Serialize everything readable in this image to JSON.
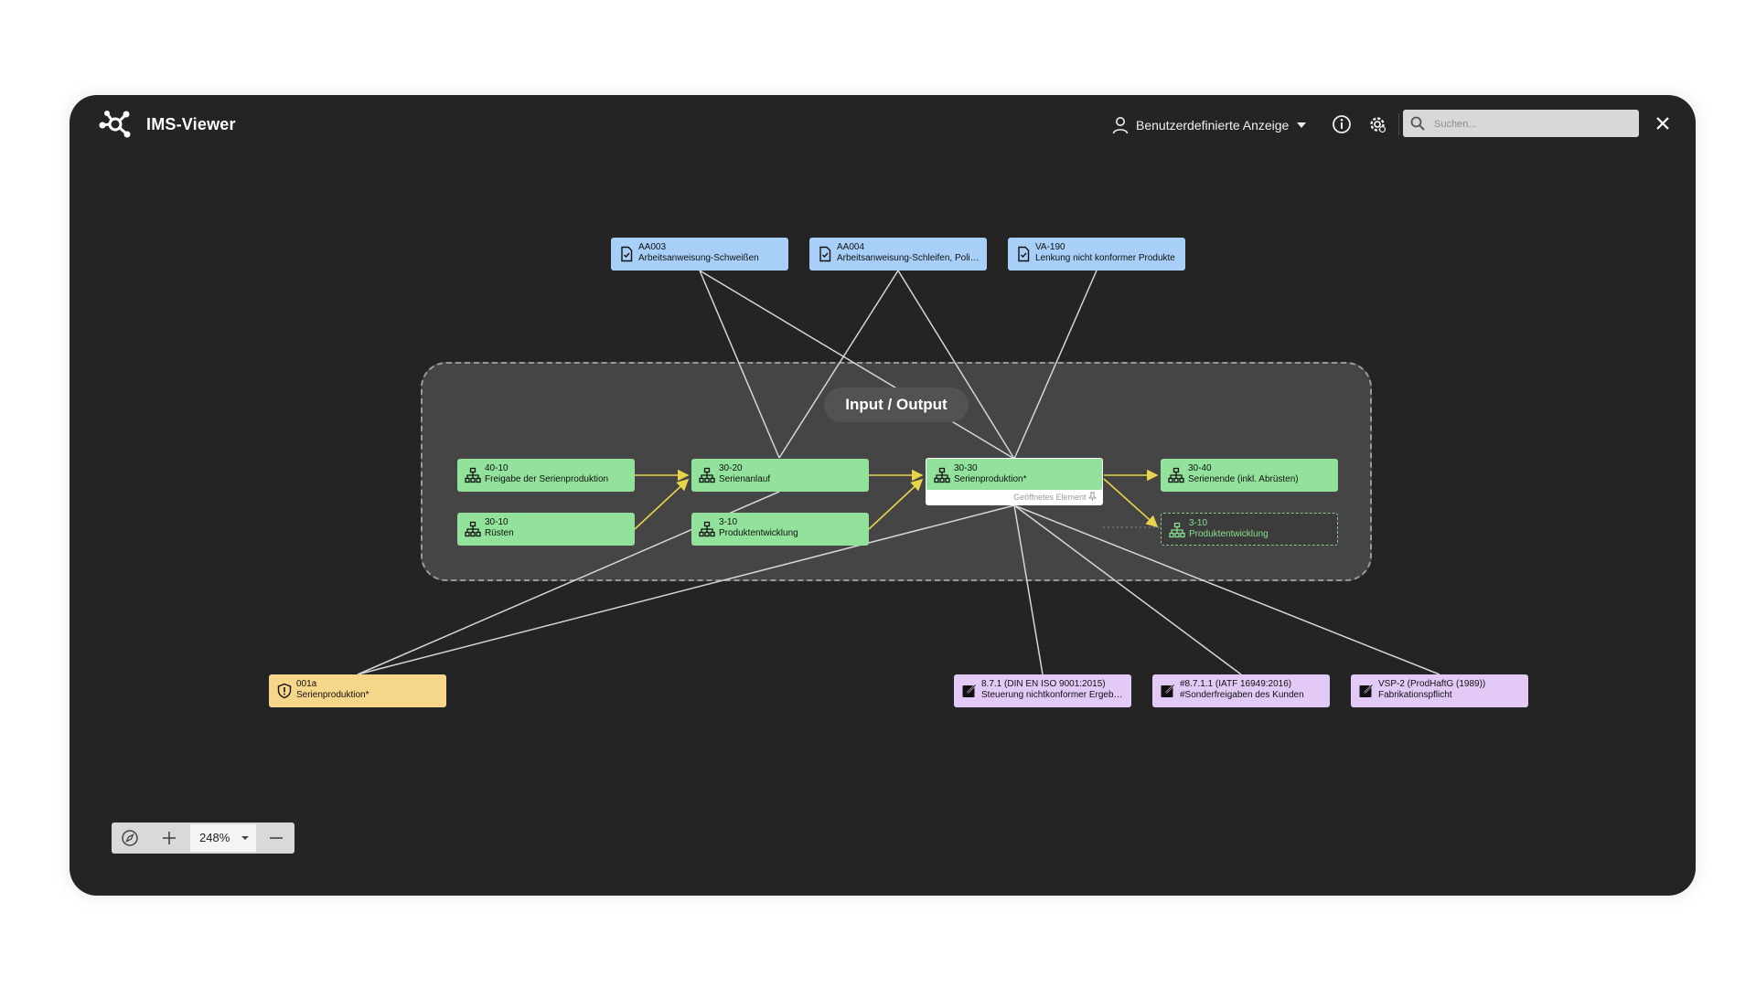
{
  "app": {
    "title": "IMS-Viewer"
  },
  "header": {
    "view_label": "Benutzerdefinierte Anzeige",
    "search_placeholder": "Suchen..."
  },
  "group": {
    "label": "Input / Output"
  },
  "nodes": {
    "aa003": {
      "code": "AA003",
      "title": "Arbeitsanweisung-Schweißen"
    },
    "aa004": {
      "code": "AA004",
      "title": "Arbeitsanweisung-Schleifen, Polier..."
    },
    "va190": {
      "code": "VA-190",
      "title": "Lenkung nicht konformer Produkte"
    },
    "p4010": {
      "code": "40-10",
      "title": "Freigabe der Serienproduktion"
    },
    "p3010": {
      "code": "30-10",
      "title": "Rüsten"
    },
    "p3020": {
      "code": "30-20",
      "title": "Serienanlauf"
    },
    "p310": {
      "code": "3-10",
      "title": "Produktentwicklung"
    },
    "p3030": {
      "code": "30-30",
      "title": "Serienproduktion*",
      "tag": "Geöffnetes Element"
    },
    "p3040": {
      "code": "30-40",
      "title": "Serienende (inkl. Abrüsten)"
    },
    "p310b": {
      "code": "3-10",
      "title": "Produktentwicklung"
    },
    "r001a": {
      "code": "001a",
      "title": "Serienproduktion*"
    },
    "n871": {
      "code": "8.7.1 (DIN EN ISO 9001:2015)",
      "title": "Steuerung nichtkonformer Ergebn..."
    },
    "n8711": {
      "code": "#8.7.1.1 (IATF 16949:2016)",
      "title": "#Sonderfreigaben des Kunden"
    },
    "vsp2": {
      "code": "VSP-2 (ProdHaftG (1989))",
      "title": "Fabrikationspflicht"
    }
  },
  "zoom": {
    "level": "248%"
  },
  "colors": {
    "document": "#a7cff7",
    "process": "#92e29c",
    "risk": "#f6d68a",
    "requirement": "#e3c9f6",
    "flow_arrow": "#e8d44a",
    "link_line": "#d6d6d6"
  },
  "icons": {
    "logo": "network-logo-icon",
    "view": "user-icon",
    "info": "info-icon",
    "settings": "gear-icon",
    "search": "search-icon",
    "close": "close-icon",
    "document": "document-check-icon",
    "process": "org-chart-icon",
    "risk": "shield-icon",
    "requirement": "external-link-icon",
    "compass": "compass-icon",
    "pin": "pin-icon"
  }
}
